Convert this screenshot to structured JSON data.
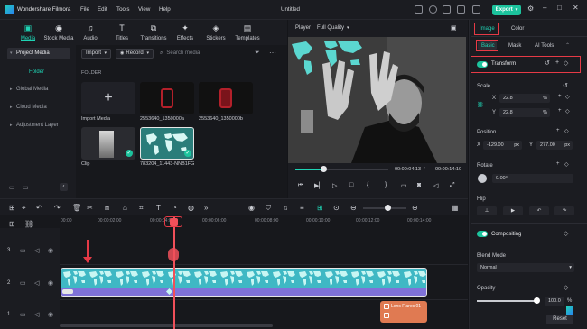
{
  "titlebar": {
    "app_name": "Wondershare Filmora",
    "menus": [
      "File",
      "Edit",
      "Tools",
      "View",
      "Help"
    ],
    "document_title": "Untitled",
    "export_label": "Export"
  },
  "media_tabs": [
    {
      "label": "Media",
      "icon": "media-icon"
    },
    {
      "label": "Stock Media",
      "icon": "stock-media-icon"
    },
    {
      "label": "Audio",
      "icon": "music-icon"
    },
    {
      "label": "Titles",
      "icon": "text-icon"
    },
    {
      "label": "Transitions",
      "icon": "transition-icon"
    },
    {
      "label": "Effects",
      "icon": "sparkle-icon"
    },
    {
      "label": "Stickers",
      "icon": "sticker-icon"
    },
    {
      "label": "Templates",
      "icon": "template-icon"
    }
  ],
  "sidebar": {
    "project_media": "Project Media",
    "folder": "Folder",
    "global_media": "Global Media",
    "cloud_media": "Cloud Media",
    "adjustment_layer": "Adjustment Layer"
  },
  "media_toolbar": {
    "import_label": "Import",
    "record_label": "Record",
    "search_placeholder": "Search media"
  },
  "folder_label": "FOLDER",
  "media_items": [
    {
      "label": "Import Media"
    },
    {
      "label": "2553640_1350000a"
    },
    {
      "label": "2553640_1350000b"
    },
    {
      "label": "Clip"
    },
    {
      "label": "783204_11443-NNB1FG"
    }
  ],
  "player": {
    "label": "Player",
    "quality": "Full Quality",
    "current_time": "00:00:04:13",
    "total_time": "00:00:14:10",
    "progress": 0.3
  },
  "right_panel": {
    "tabs": [
      "Image",
      "Color"
    ],
    "subtabs": [
      "Basic",
      "Mask",
      "AI Tools"
    ],
    "transform": "Transform",
    "scale": "Scale",
    "scale_x_label": "X",
    "scale_x": "22.8",
    "scale_y_label": "Y",
    "scale_y": "22.8",
    "percent": "%",
    "position": "Position",
    "pos_x_label": "X",
    "pos_x": "-129.00",
    "pos_y_label": "Y",
    "pos_y": "277.00",
    "px": "px",
    "rotate": "Rotate",
    "rotate_value": "0.00°",
    "flip": "Flip",
    "compositing": "Compositing",
    "blend_mode": "Blend Mode",
    "blend_value": "Normal",
    "opacity": "Opacity",
    "opacity_value": "100.0",
    "opacity_unit": "%",
    "reset": "Reset"
  },
  "timeline": {
    "ruler": [
      "00:00",
      "00:00:02:00",
      "00:00:04:00",
      "00:00:06:00",
      "00:00:08:00",
      "00:00:10:00",
      "00:00:12:00",
      "00:00:14:00"
    ],
    "track_numbers": [
      "3",
      "2",
      "1"
    ],
    "clip_label": "Lens Flares 01"
  },
  "colors": {
    "accent": "#1fd3b4",
    "highlight": "#e63a46",
    "clip_purple": "#7b6ad6",
    "clip_orange": "#e07a52"
  }
}
